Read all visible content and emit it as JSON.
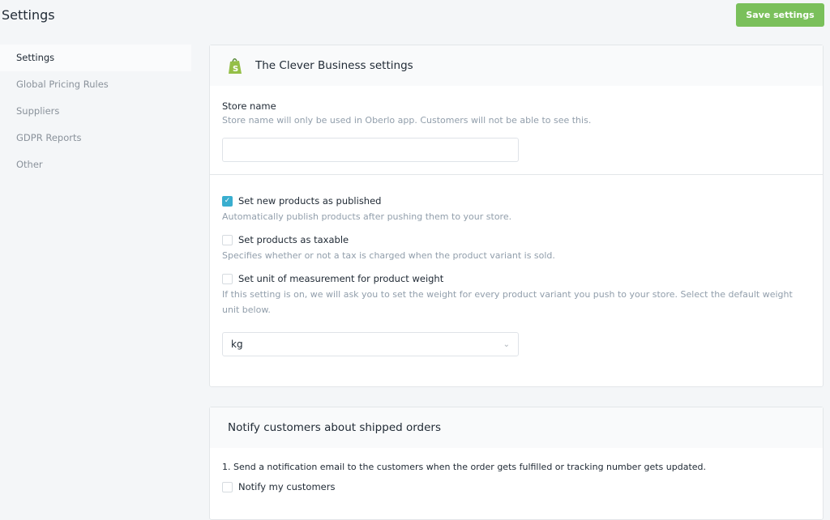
{
  "header": {
    "title": "Settings",
    "save_label": "Save settings"
  },
  "sidebar": {
    "items": [
      {
        "label": "Settings",
        "active": true
      },
      {
        "label": "Global Pricing Rules"
      },
      {
        "label": "Suppliers"
      },
      {
        "label": "GDPR Reports"
      },
      {
        "label": "Other"
      }
    ]
  },
  "store_card": {
    "title": "The Clever Business settings",
    "store_name": {
      "label": "Store name",
      "help": "Store name will only be used in Oberlo app. Customers will not be able to see this.",
      "value": ""
    },
    "options": [
      {
        "label": "Set new products as published",
        "help": "Automatically publish products after pushing them to your store.",
        "checked": true
      },
      {
        "label": "Set products as taxable",
        "help": "Specifies whether or not a tax is charged when the product variant is sold.",
        "checked": false
      },
      {
        "label": "Set unit of measurement for product weight",
        "help": "If this setting is on, we will ask you to set the weight for every product variant you push to your store. Select the default weight unit below.",
        "checked": false
      }
    ],
    "weight_unit": "kg"
  },
  "notify_card": {
    "title": "Notify customers about shipped orders",
    "step1": "1. Send a notification email to the customers when the order gets fulfilled or tracking number gets updated.",
    "checkbox_label": "Notify my customers",
    "checked": false
  },
  "colors": {
    "accent": "#7ac05b",
    "checkbox": "#39aecf"
  }
}
